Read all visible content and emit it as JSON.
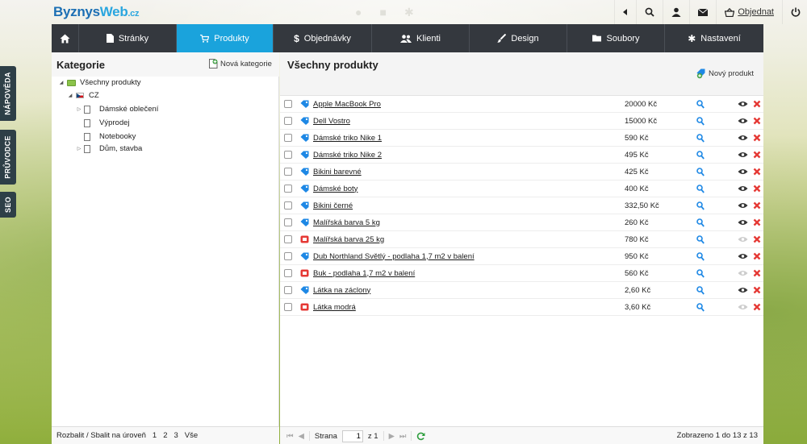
{
  "header": {
    "logo_part1": "Byznys",
    "logo_part2": "Web",
    "logo_part3": ".cz",
    "order_label": "Objednat",
    "icons": [
      "back-arrow-icon",
      "search-icon",
      "user-icon",
      "mail-icon",
      "basket-icon",
      "power-icon"
    ]
  },
  "nav": {
    "items": [
      {
        "label": "Stránky",
        "icon": "page-icon"
      },
      {
        "label": "Produkty",
        "icon": "cart-icon",
        "active": true
      },
      {
        "label": "Objednávky",
        "icon": "dollar-icon"
      },
      {
        "label": "Klienti",
        "icon": "users-icon"
      },
      {
        "label": "Design",
        "icon": "brush-icon"
      },
      {
        "label": "Soubory",
        "icon": "folder-icon"
      },
      {
        "label": "Nastavení",
        "icon": "gear-icon"
      }
    ]
  },
  "side_tabs": [
    "NÁPOVĚDA",
    "PRŮVODCE",
    "SEO"
  ],
  "categories": {
    "title": "Kategorie",
    "new_label": "Nová kategorie",
    "tree": [
      {
        "label": "Všechny produkty"
      },
      {
        "label": "CZ"
      },
      {
        "label": "Dámské oblečení"
      },
      {
        "label": "Výprodej"
      },
      {
        "label": "Notebooky"
      },
      {
        "label": "Dům, stavba"
      }
    ],
    "footer": {
      "label": "Rozbalit / Sbalit na úroveň",
      "levels": [
        "1",
        "2",
        "3",
        "Vše"
      ]
    }
  },
  "products": {
    "title": "Všechny produkty",
    "new_label": "Nový produkt",
    "rows": [
      {
        "name": "Apple MacBook Pro",
        "price": "20000 Kč",
        "tag": "blue",
        "visible": true
      },
      {
        "name": "Dell Vostro",
        "price": "15000 Kč",
        "tag": "blue",
        "visible": true
      },
      {
        "name": "Dámské triko Nike 1",
        "price": "590 Kč",
        "tag": "blue",
        "visible": true
      },
      {
        "name": "Dámské triko Nike 2",
        "price": "495 Kč",
        "tag": "blue",
        "visible": true
      },
      {
        "name": "Bikini barevné",
        "price": "425 Kč",
        "tag": "blue",
        "visible": true
      },
      {
        "name": "Dámské boty",
        "price": "400 Kč",
        "tag": "blue",
        "visible": true
      },
      {
        "name": "Bikini černé",
        "price": "332,50 Kč",
        "tag": "blue",
        "visible": true
      },
      {
        "name": "Malířská barva 5 kg",
        "price": "260 Kč",
        "tag": "blue",
        "visible": true
      },
      {
        "name": "Malířská barva 25 kg",
        "price": "780 Kč",
        "tag": "red",
        "visible": false
      },
      {
        "name": "Dub Northland Světlý - podlaha 1,7 m2 v balení",
        "price": "950 Kč",
        "tag": "blue",
        "visible": true
      },
      {
        "name": "Buk - podlaha 1,7 m2 v balení",
        "price": "560 Kč",
        "tag": "red",
        "visible": false
      },
      {
        "name": "Látka na záclony",
        "price": "2,60 Kč",
        "tag": "blue",
        "visible": true
      },
      {
        "name": "Látka modrá",
        "price": "3,60 Kč",
        "tag": "red",
        "visible": false
      }
    ],
    "footer": {
      "page_label": "Strana",
      "page_value": "1",
      "page_of": "z 1",
      "shown": "Zobrazeno 1 do 13 z 13"
    }
  },
  "colors": {
    "nav_bg": "#34383e",
    "nav_active": "#1aa3dc",
    "delete": "#e53935",
    "tag_blue": "#1e88e5",
    "tag_red": "#e53935"
  }
}
